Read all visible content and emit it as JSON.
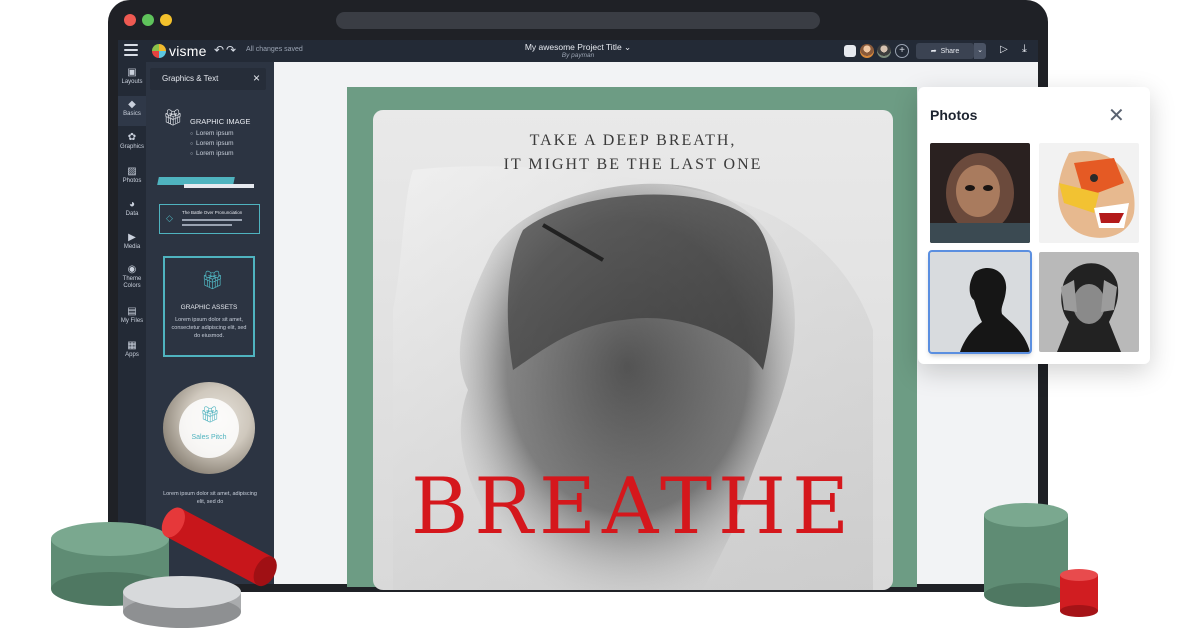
{
  "toolbar": {
    "brand": "visme",
    "save_status": "All changes saved",
    "project_title": "My awesome Project Title",
    "project_by": "By payman",
    "share_label": "Share"
  },
  "rail": {
    "items": [
      {
        "label": "Layouts",
        "icon": "layouts-icon"
      },
      {
        "label": "Basics",
        "icon": "shapes-icon"
      },
      {
        "label": "Graphics",
        "icon": "graphics-icon"
      },
      {
        "label": "Photos",
        "icon": "image-icon"
      },
      {
        "label": "Data",
        "icon": "chart-icon"
      },
      {
        "label": "Media",
        "icon": "video-icon"
      },
      {
        "label": "Theme",
        "label2": "Colors",
        "icon": "palette-icon"
      },
      {
        "label": "My Files",
        "icon": "folder-icon"
      },
      {
        "label": "Apps",
        "icon": "apps-icon"
      }
    ],
    "active": "Basics"
  },
  "panel": {
    "title": "Graphics & Text",
    "graphic_image": {
      "heading": "GRAPHIC IMAGE",
      "bullets": [
        "Lorem ipsum",
        "Lorem ipsum",
        "Lorem ipsum"
      ]
    },
    "callout_title": "The Battle Over Pronunciation",
    "graphic_assets": {
      "heading": "GRAPHIC ASSETS",
      "body": "Lorem ipsum dolor sit amet, consectetur adipiscing elit, sed do eiusmod."
    },
    "circle_label": "Sales Pitch",
    "footer_text": "Lorem ipsum dolor sit amet, adipiscing elit, sed do"
  },
  "poster": {
    "tagline_1": "TAKE A DEEP BREATH,",
    "tagline_2": "IT MIGHT BE THE LAST ONE",
    "headline": "BREATHE",
    "headline_color": "#d5171c",
    "frame_color": "#6d9c84"
  },
  "photos_panel": {
    "title": "Photos",
    "selected_index": 2,
    "count": 4
  },
  "colors": {
    "accent": "#4fb3bf",
    "chrome": "#232a36",
    "deco_green": "#6d9c84",
    "deco_red": "#e01f1f"
  }
}
